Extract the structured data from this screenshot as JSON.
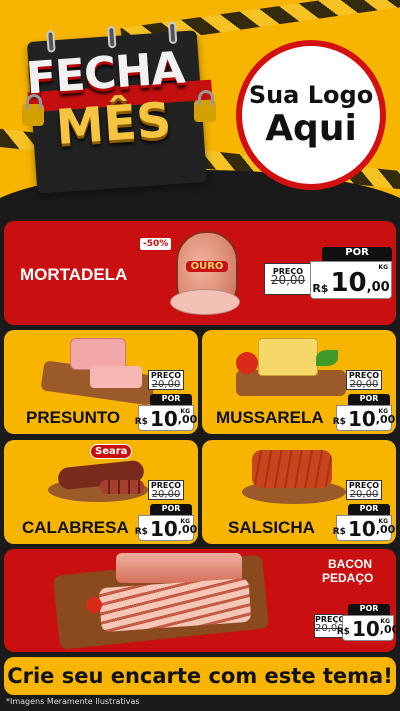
{
  "header": {
    "title_line1": "FECHA",
    "title_line2": "MÊS",
    "logo_line1": "Sua Logo",
    "logo_line2": "Aqui"
  },
  "labels": {
    "old_price": "PREÇO",
    "new_price": "POR",
    "currency": "R$",
    "unit": "KG"
  },
  "products": {
    "mortadela": {
      "name": "MORTADELA",
      "old": "20,00",
      "int": "10",
      "dec": ",00",
      "badge": "-50%",
      "brand": "OURO"
    },
    "presunto": {
      "name": "PRESUNTO",
      "old": "20,00",
      "int": "10",
      "dec": ",00"
    },
    "mussarela": {
      "name": "MUSSARELA",
      "old": "20,00",
      "int": "10",
      "dec": ",00"
    },
    "calabresa": {
      "name": "CALABRESA",
      "old": "20,00",
      "int": "10",
      "dec": ",00",
      "brand": "Seara"
    },
    "salsicha": {
      "name": "SALSICHA",
      "old": "20,00",
      "int": "10",
      "dec": ",00"
    },
    "bacon": {
      "name_line1": "BACON",
      "name_line2": "PEDAÇO",
      "old": "20,00",
      "int": "10",
      "dec": ",00"
    }
  },
  "footer": {
    "cta": "Crie seu encarte com este tema!",
    "note": "*Imagens Meramente Ilustrativas"
  },
  "colors": {
    "red": "#c90f0f",
    "yellow": "#f7b500",
    "dark": "#1a1a1a"
  }
}
